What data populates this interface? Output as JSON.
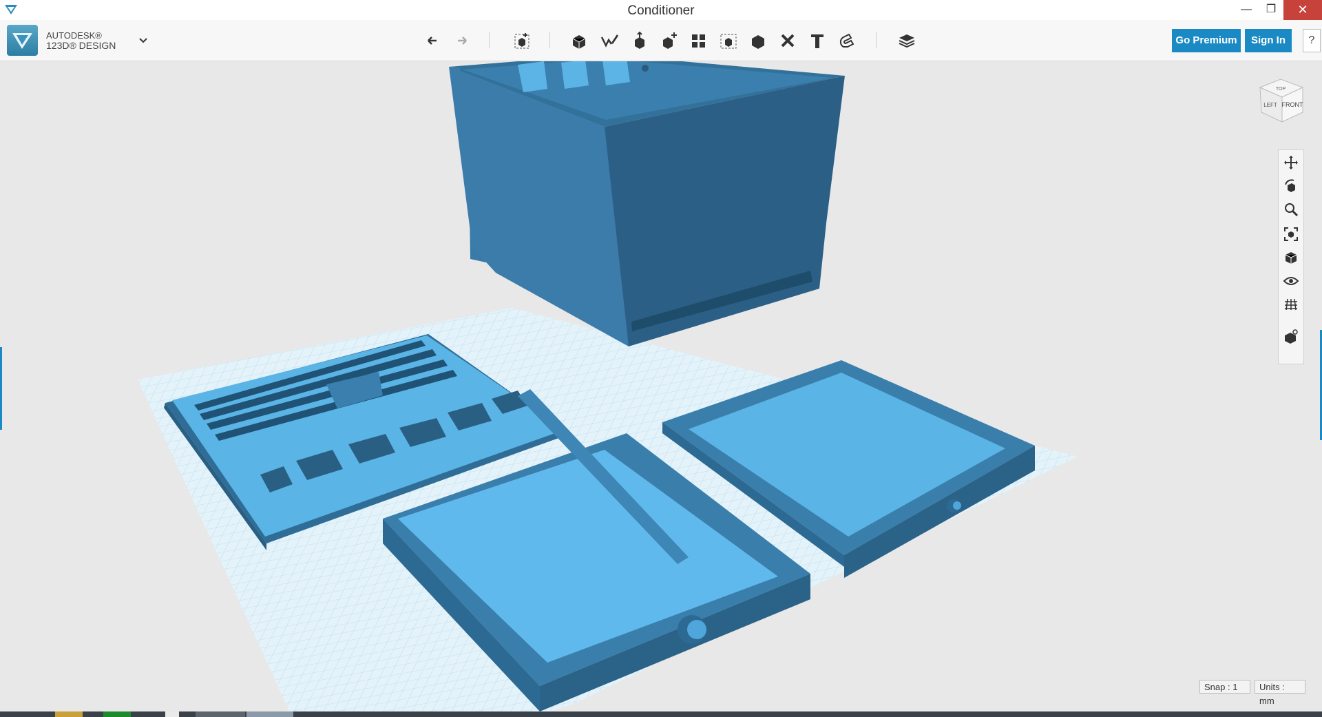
{
  "window": {
    "title": "Conditioner",
    "minimize_glyph": "—",
    "maximize_glyph": "❐",
    "close_glyph": "✕"
  },
  "brand": {
    "line1": "AUTODESK®",
    "line2": "123D® DESIGN",
    "menu_icon": "chevron-down-icon"
  },
  "toolbar": {
    "icons": [
      "undo-icon",
      "redo-icon",
      "transform-icon",
      "primitives-icon",
      "sketch-icon",
      "construct-icon",
      "modify-icon",
      "pattern-icon",
      "grouping-icon",
      "combine-icon",
      "measure-icon",
      "text-icon",
      "snap-icon",
      "material-icon"
    ],
    "premium_label": "Go Premium",
    "signin_label": "Sign In",
    "help_label": "?"
  },
  "viewcube": {
    "left_label": "LEFT",
    "front_label": "FRONT",
    "top_label": "TOP"
  },
  "navbar": {
    "icons": [
      "pan-icon",
      "orbit-icon",
      "zoom-icon",
      "fit-icon",
      "view-mode-icon",
      "visibility-icon",
      "grid-icon",
      "material-icon"
    ]
  },
  "status": {
    "snap": "Snap : 1",
    "units": "Units : mm"
  },
  "colors": {
    "accent": "#1b8ac4",
    "model_top": "#5ab4e6",
    "model_side": "#3a7eab",
    "model_dark": "#2b6288",
    "grid": "#a9d6ee"
  }
}
